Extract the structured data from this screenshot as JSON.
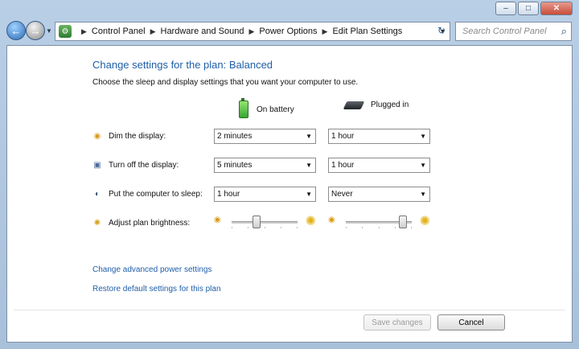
{
  "window": {
    "controls": [
      "–",
      "□",
      "✕"
    ]
  },
  "nav": {
    "breadcrumbs": [
      "Control Panel",
      "Hardware and Sound",
      "Power Options",
      "Edit Plan Settings"
    ],
    "search_placeholder": "Search Control Panel"
  },
  "page": {
    "title": "Change settings for the plan: Balanced",
    "subtitle": "Choose the sleep and display settings that you want your computer to use.",
    "columns": [
      "On battery",
      "Plugged in"
    ],
    "rows": [
      {
        "label": "Dim the display:",
        "battery": "2 minutes",
        "plugged": "1 hour"
      },
      {
        "label": "Turn off the display:",
        "battery": "5 minutes",
        "plugged": "1 hour"
      },
      {
        "label": "Put the computer to sleep:",
        "battery": "1 hour",
        "plugged": "Never"
      }
    ],
    "brightness_label": "Adjust plan brightness:",
    "brightness": {
      "battery": 0.38,
      "plugged": 0.86
    },
    "links": [
      "Change advanced power settings",
      "Restore default settings for this plan"
    ],
    "buttons": {
      "save": "Save changes",
      "cancel": "Cancel"
    }
  },
  "icons": {
    "dim": "sun-dim-icon",
    "display": "monitor-icon",
    "sleep": "moon-icon",
    "brightness": "sun-icon",
    "battery": "battery-icon",
    "plugged": "power-plug-icon"
  }
}
